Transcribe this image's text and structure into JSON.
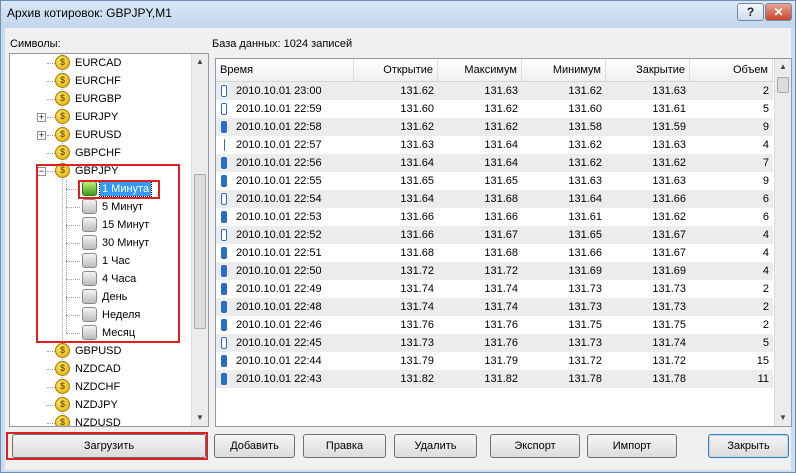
{
  "window": {
    "title": "Архив котировок: GBPJPY,M1",
    "help_label": "?",
    "close_label": "✕"
  },
  "labels": {
    "symbols": "Символы:",
    "database": "База данных: 1024 записей"
  },
  "tree": {
    "symbols_top": [
      "EURCAD",
      "EURCHF",
      "EURGBP",
      "EURJPY",
      "EURUSD",
      "GBPCHF"
    ],
    "selected_symbol": "GBPJPY",
    "timeframes": [
      "1 Минута",
      "5 Минут",
      "15 Минут",
      "30 Минут",
      "1 Час",
      "4 Часа",
      "День",
      "Неделя",
      "Месяц"
    ],
    "selected_timeframe": "1 Минута",
    "symbols_bottom": [
      "GBPUSD",
      "NZDCAD",
      "NZDCHF",
      "NZDJPY",
      "NZDUSD"
    ],
    "coin_glyph": "$"
  },
  "table": {
    "columns": [
      "Время",
      "Открытие",
      "Максимум",
      "Минимум",
      "Закрытие",
      "Объем"
    ],
    "rows": [
      {
        "t": "2010.10.01 23:00",
        "o": "131.62",
        "h": "131.63",
        "l": "131.62",
        "c": "131.63",
        "v": "2",
        "icon": "hollow"
      },
      {
        "t": "2010.10.01 22:59",
        "o": "131.60",
        "h": "131.62",
        "l": "131.60",
        "c": "131.61",
        "v": "5",
        "icon": "hollow"
      },
      {
        "t": "2010.10.01 22:58",
        "o": "131.62",
        "h": "131.62",
        "l": "131.58",
        "c": "131.59",
        "v": "9",
        "icon": "filled"
      },
      {
        "t": "2010.10.01 22:57",
        "o": "131.63",
        "h": "131.64",
        "l": "131.62",
        "c": "131.63",
        "v": "4",
        "icon": "tick"
      },
      {
        "t": "2010.10.01 22:56",
        "o": "131.64",
        "h": "131.64",
        "l": "131.62",
        "c": "131.62",
        "v": "7",
        "icon": "filled"
      },
      {
        "t": "2010.10.01 22:55",
        "o": "131.65",
        "h": "131.65",
        "l": "131.63",
        "c": "131.63",
        "v": "9",
        "icon": "filled"
      },
      {
        "t": "2010.10.01 22:54",
        "o": "131.64",
        "h": "131.68",
        "l": "131.64",
        "c": "131.66",
        "v": "6",
        "icon": "hollow"
      },
      {
        "t": "2010.10.01 22:53",
        "o": "131.66",
        "h": "131.66",
        "l": "131.61",
        "c": "131.62",
        "v": "6",
        "icon": "filled"
      },
      {
        "t": "2010.10.01 22:52",
        "o": "131.66",
        "h": "131.67",
        "l": "131.65",
        "c": "131.67",
        "v": "4",
        "icon": "hollow"
      },
      {
        "t": "2010.10.01 22:51",
        "o": "131.68",
        "h": "131.68",
        "l": "131.66",
        "c": "131.67",
        "v": "4",
        "icon": "filled"
      },
      {
        "t": "2010.10.01 22:50",
        "o": "131.72",
        "h": "131.72",
        "l": "131.69",
        "c": "131.69",
        "v": "4",
        "icon": "filled"
      },
      {
        "t": "2010.10.01 22:49",
        "o": "131.74",
        "h": "131.74",
        "l": "131.73",
        "c": "131.73",
        "v": "2",
        "icon": "filled"
      },
      {
        "t": "2010.10.01 22:48",
        "o": "131.74",
        "h": "131.74",
        "l": "131.73",
        "c": "131.73",
        "v": "2",
        "icon": "filled"
      },
      {
        "t": "2010.10.01 22:46",
        "o": "131.76",
        "h": "131.76",
        "l": "131.75",
        "c": "131.75",
        "v": "2",
        "icon": "filled"
      },
      {
        "t": "2010.10.01 22:45",
        "o": "131.73",
        "h": "131.76",
        "l": "131.73",
        "c": "131.74",
        "v": "5",
        "icon": "hollow"
      },
      {
        "t": "2010.10.01 22:44",
        "o": "131.79",
        "h": "131.79",
        "l": "131.72",
        "c": "131.72",
        "v": "15",
        "icon": "filled"
      },
      {
        "t": "2010.10.01 22:43",
        "o": "131.82",
        "h": "131.82",
        "l": "131.78",
        "c": "131.78",
        "v": "11",
        "icon": "filled"
      }
    ]
  },
  "buttons": {
    "load": "Загрузить",
    "add": "Добавить",
    "edit": "Правка",
    "delete": "Удалить",
    "export": "Экспорт",
    "import": "Импорт",
    "close": "Закрыть"
  },
  "colors": {
    "highlight": "#e02020",
    "selection": "#3399ff",
    "candle": "#2a6dc9"
  }
}
